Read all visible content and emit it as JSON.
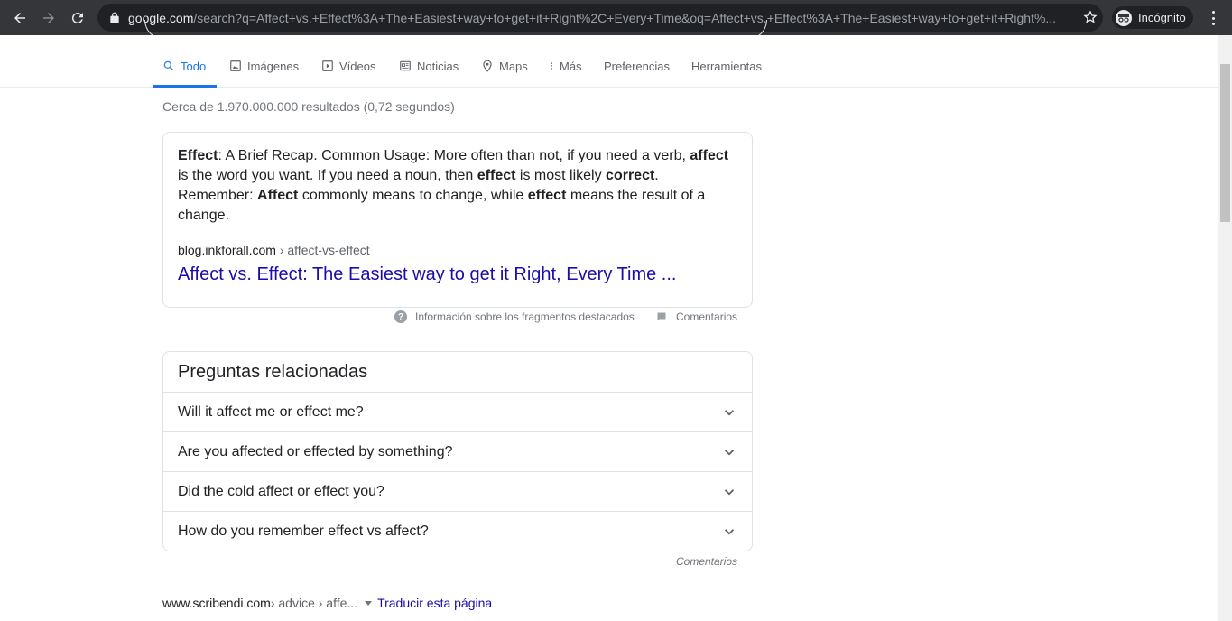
{
  "browser": {
    "url_host": "google.com",
    "url_rest": "/search?q=Affect+vs.+Effect%3A+The+Easiest+way+to+get+it+Right%2C+Every+Time&oq=Affect+vs.+Effect%3A+The+Easiest+way+to+get+it+Right%...",
    "incognito_label": "Incógnito"
  },
  "tabs": [
    {
      "label": "Todo",
      "icon": "search-icon"
    },
    {
      "label": "Imágenes",
      "icon": "image-icon"
    },
    {
      "label": "Vídeos",
      "icon": "video-icon"
    },
    {
      "label": "Noticias",
      "icon": "news-icon"
    },
    {
      "label": "Maps",
      "icon": "map-pin-icon"
    },
    {
      "label": "Más",
      "icon": "more-vert-icon"
    },
    {
      "label": "Preferencias"
    },
    {
      "label": "Herramientas"
    }
  ],
  "result_stats": "Cerca de 1.970.000.000 resultados (0,72 segundos)",
  "snippet": {
    "parts": [
      {
        "t": "Effect",
        "b": true
      },
      {
        "t": ": A Brief Recap. Common Usage: More often than not, if you need a verb, ",
        "b": false
      },
      {
        "t": "affect",
        "b": true
      },
      {
        "t": " is the word you want. If you need a noun, then ",
        "b": false
      },
      {
        "t": "effect",
        "b": true
      },
      {
        "t": " is most likely ",
        "b": false
      },
      {
        "t": "correct",
        "b": true
      },
      {
        "t": ". Remember: ",
        "b": false
      },
      {
        "t": "Affect",
        "b": true
      },
      {
        "t": " commonly means to change, while ",
        "b": false
      },
      {
        "t": "effect",
        "b": true
      },
      {
        "t": " means the result of a change.",
        "b": false
      }
    ],
    "cite_host": "blog.inkforall.com",
    "cite_path": " › affect-vs-effect",
    "link_text": "Affect vs. Effect: The Easiest way to get it Right, Every Time ...",
    "info_label": "Información sobre los fragmentos destacados",
    "feedback_label": "Comentarios"
  },
  "related": {
    "title": "Preguntas relacionadas",
    "questions": [
      "Will it affect me or effect me?",
      "Are you affected or effected by something?",
      "Did the cold affect or effect you?",
      "How do you remember effect vs affect?"
    ],
    "feedback_label": "Comentarios"
  },
  "next_result": {
    "host": "www.scribendi.com",
    "path": " › advice › affe...",
    "translate_label": "Traducir esta página"
  }
}
